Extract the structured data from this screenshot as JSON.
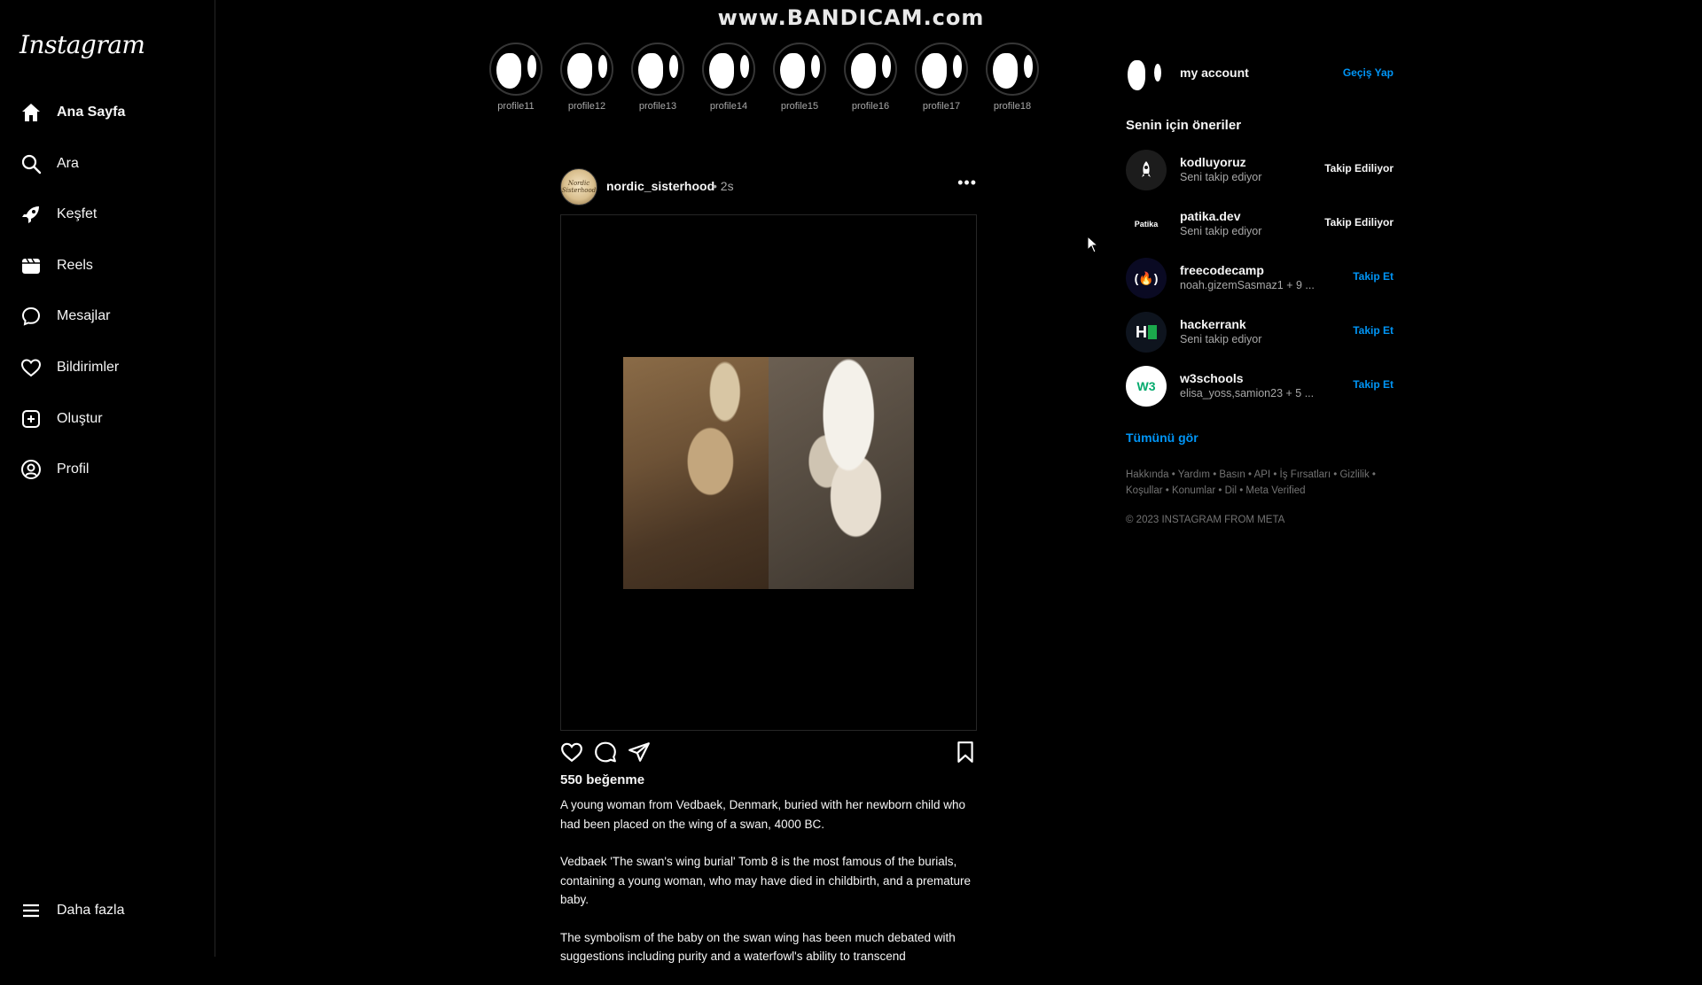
{
  "watermark": "www.BANDICAM.com",
  "sidebar": {
    "logo": "Instagram",
    "items": [
      {
        "label": "Ana Sayfa",
        "icon": "home-icon"
      },
      {
        "label": "Ara",
        "icon": "search-icon"
      },
      {
        "label": "Keşfet",
        "icon": "rocket-icon"
      },
      {
        "label": "Reels",
        "icon": "reels-icon"
      },
      {
        "label": "Mesajlar",
        "icon": "message-icon"
      },
      {
        "label": "Bildirimler",
        "icon": "heart-icon"
      },
      {
        "label": "Oluştur",
        "icon": "plus-square-icon"
      },
      {
        "label": "Profil",
        "icon": "profile-icon"
      }
    ],
    "more_label": "Daha fazla"
  },
  "stories": [
    "profile11",
    "profile12",
    "profile13",
    "profile14",
    "profile15",
    "profile16",
    "profile17",
    "profile18"
  ],
  "post": {
    "username": "nordic_sisterhood",
    "time": "• 2s",
    "avatar_text": "Nordic Sisterhood",
    "likes": "550 beğenme",
    "caption": [
      "A young woman from Vedbaek, Denmark, buried with her newborn child who had been placed on the wing of a swan, 4000 BC.",
      "Vedbaek 'The swan's wing burial' Tomb 8 is the most famous of the burials, containing a young woman, who may have died in childbirth, and a premature baby.",
      "The symbolism of the baby on the swan wing has been much debated with suggestions including purity and a waterfowl's ability to transcend"
    ]
  },
  "account": {
    "name": "my account",
    "switch_label": "Geçiş Yap"
  },
  "suggestions": {
    "title": "Senin için öneriler",
    "items": [
      {
        "name": "kodluyoruz",
        "sub": "Seni takip ediyor",
        "button": "Takip Ediliyor",
        "state": "following"
      },
      {
        "name": "patika.dev",
        "sub": "Seni takip ediyor",
        "button": "Takip Ediliyor",
        "state": "following",
        "avatar_text": "Patika"
      },
      {
        "name": "freecodecamp",
        "sub": "noah.gizemSasmaz1 + 9 ...",
        "button": "Takip Et",
        "state": "follow",
        "avatar_text": "(🔥)"
      },
      {
        "name": "hackerrank",
        "sub": "Seni takip ediyor",
        "button": "Takip Et",
        "state": "follow",
        "avatar_text": "H"
      },
      {
        "name": "w3schools",
        "sub": "elisa_yoss,samion23 + 5 ...",
        "button": "Takip Et",
        "state": "follow",
        "avatar_text": "W3"
      }
    ],
    "see_all": "Tümünü gör"
  },
  "footer": {
    "links": "Hakkında • Yardım • Basın • API • İş Fırsatları • Gizlilik • Koşullar • Konumlar • Dil • Meta Verified",
    "copyright": "© 2023 INSTAGRAM FROM META"
  },
  "colors": {
    "background": "#000000",
    "link_blue": "#0095f6",
    "muted": "#a8a8a8",
    "border": "#262626"
  }
}
